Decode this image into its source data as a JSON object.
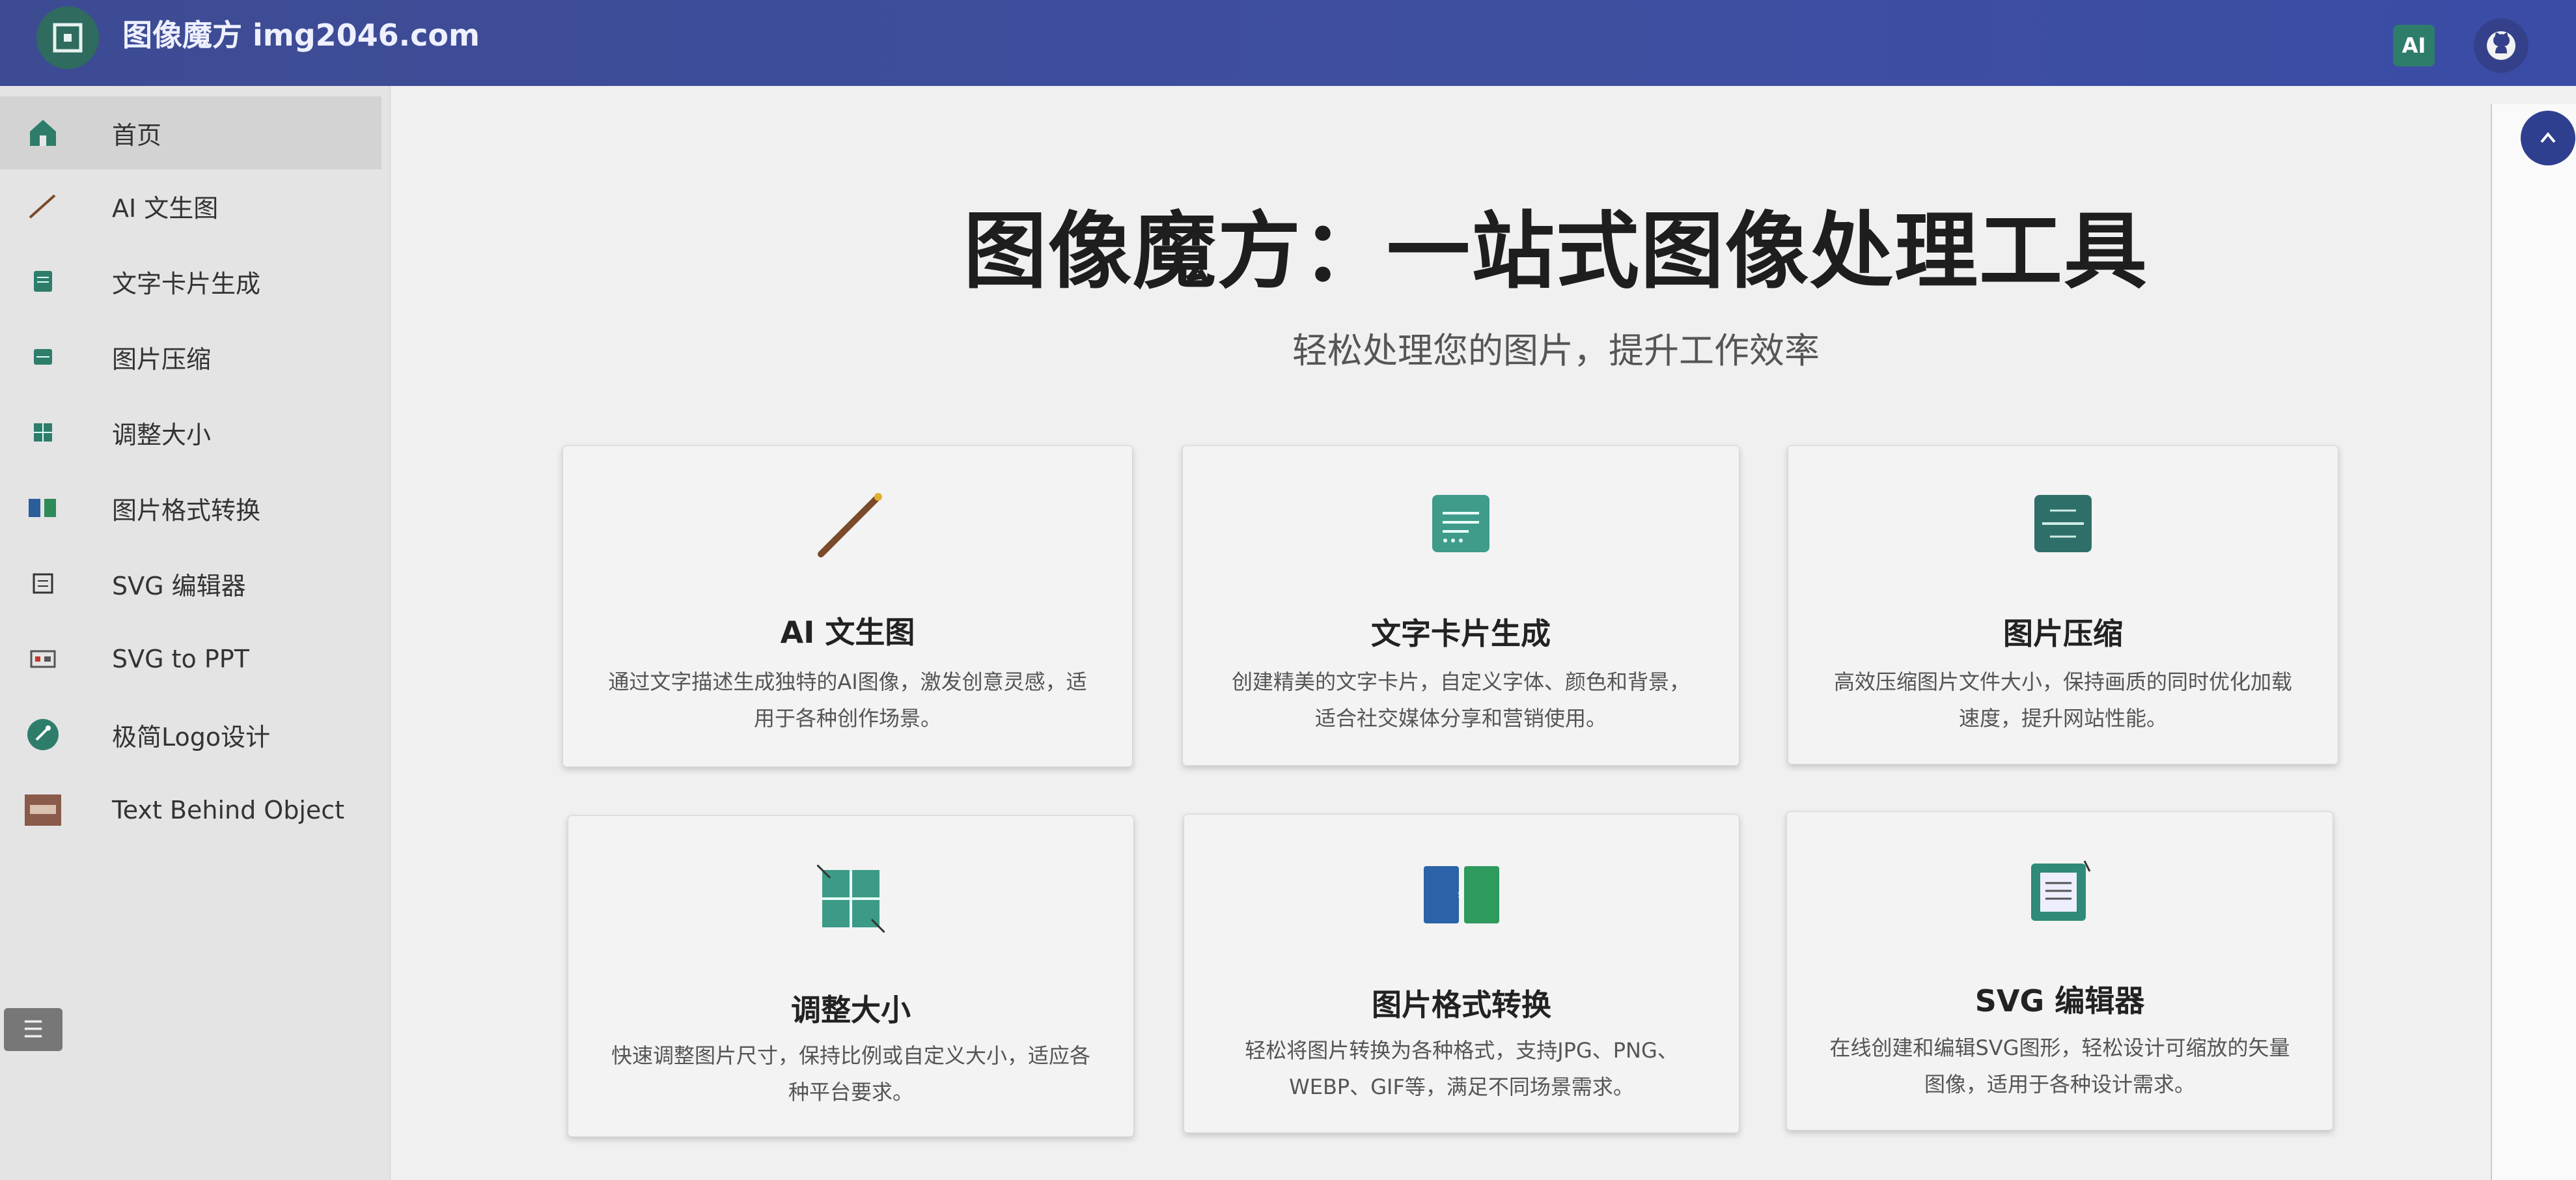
{
  "header": {
    "title": "图像魔方 img2046.com",
    "ai_badge": "AI",
    "icons": {
      "logo": "logo-icon",
      "github": "github-icon"
    }
  },
  "sidebar": {
    "items": [
      {
        "label": "首页",
        "icon": "home-icon",
        "active": true
      },
      {
        "label": "AI 文生图",
        "icon": "wand-icon"
      },
      {
        "label": "文字卡片生成",
        "icon": "card-icon"
      },
      {
        "label": "图片压缩",
        "icon": "compress-icon"
      },
      {
        "label": "调整大小",
        "icon": "resize-icon"
      },
      {
        "label": "图片格式转换",
        "icon": "convert-icon"
      },
      {
        "label": "SVG 编辑器",
        "icon": "svg-editor-icon"
      },
      {
        "label": "SVG to PPT",
        "icon": "ppt-icon"
      },
      {
        "label": "极简Logo设计",
        "icon": "logo-design-icon"
      },
      {
        "label": "Text Behind Object",
        "icon": "text-behind-icon"
      }
    ],
    "toggle_icon": "menu-icon",
    "toggle_glyph": "☰"
  },
  "main": {
    "title": "图像魔方：一站式图像处理工具",
    "subtitle": "轻松处理您的图片，提升工作效率",
    "cards": [
      {
        "title": "AI 文生图",
        "desc": "通过文字描述生成独特的AI图像，激发创意灵感，适用于各种创作场景。",
        "icon": "wand-icon"
      },
      {
        "title": "文字卡片生成",
        "desc": "创建精美的文字卡片，自定义字体、颜色和背景，适合社交媒体分享和营销使用。",
        "icon": "text-card-icon"
      },
      {
        "title": "图片压缩",
        "desc": "高效压缩图片文件大小，保持画质的同时优化加载速度，提升网站性能。",
        "icon": "compress-icon"
      },
      {
        "title": "调整大小",
        "desc": "快速调整图片尺寸，保持比例或自定义大小，适应各种平台要求。",
        "icon": "resize-icon"
      },
      {
        "title": "图片格式转换",
        "desc": "轻松将图片转换为各种格式，支持JPG、PNG、WEBP、GIF等，满足不同场景需求。",
        "icon": "convert-icon"
      },
      {
        "title": "SVG 编辑器",
        "desc": "在线创建和编辑SVG图形，轻松设计可缩放的矢量图像，适用于各种设计需求。",
        "icon": "svg-editor-icon"
      }
    ]
  },
  "colors": {
    "header_bg": "#3f4fa0",
    "accent_green": "#2e7d6b",
    "sidebar_bg": "#e4e4e4",
    "card_bg": "#f3f3f3"
  }
}
